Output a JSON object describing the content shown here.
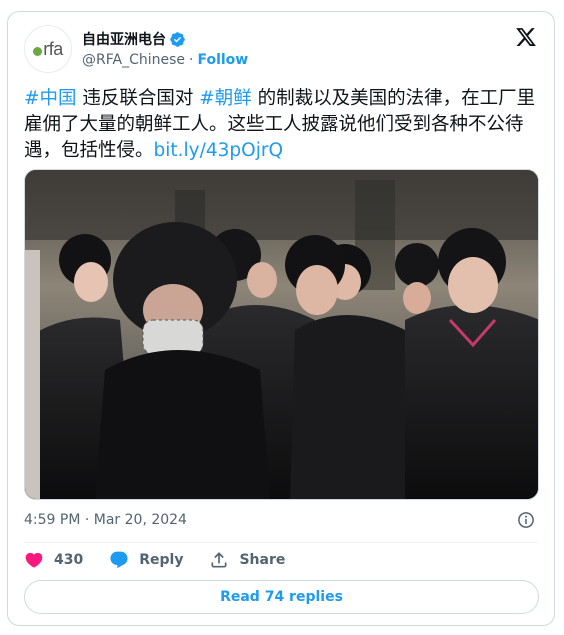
{
  "account": {
    "name": "自由亚洲电台",
    "handle": "@RFA_Chinese",
    "separator": "·",
    "follow_label": "Follow",
    "avatar_logo_text": "rfa"
  },
  "tweet": {
    "hashtag_1": "#中国",
    "text_1": " 违反联合国对 ",
    "hashtag_2": "#朝鲜",
    "text_2": " 的制裁以及美国的法律，在工厂里雇佣了大量的朝鲜工人。这些工人披露说他们受到各种不公待遇，包括性侵。",
    "link": "bit.ly/43pOjrQ"
  },
  "meta": {
    "timestamp": "4:59 PM · Mar 20, 2024"
  },
  "actions": {
    "like_count": "430",
    "reply_label": "Reply",
    "share_label": "Share"
  },
  "read_replies_label": "Read 74 replies",
  "colors": {
    "accent": "#1d9bf0",
    "like": "#f91880",
    "text": "#0f1419",
    "muted": "#536471",
    "border": "#cfd9de"
  },
  "icons": [
    "verified-badge-icon",
    "x-logo-icon",
    "info-icon",
    "heart-icon",
    "reply-bubble-icon",
    "share-icon"
  ]
}
